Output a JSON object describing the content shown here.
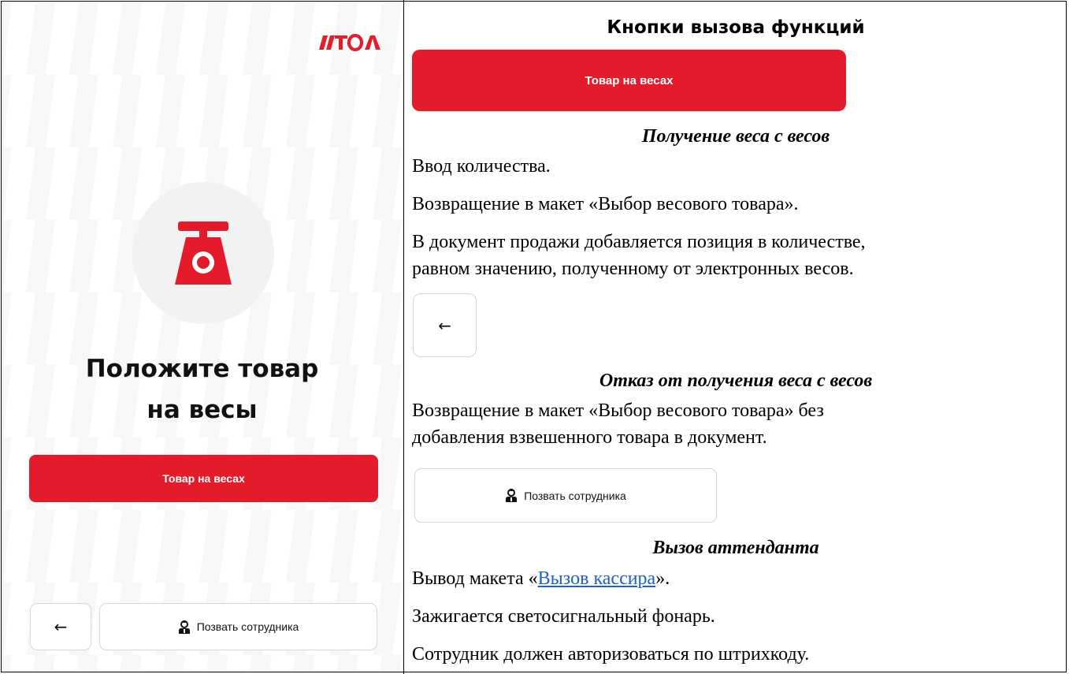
{
  "phone": {
    "logo": "ATOL",
    "title_line1": "Положите товар",
    "title_line2": "на весы",
    "weigh_button": "Товар на весах",
    "back_arrow": "←",
    "call_button": "Позвать сотрудника",
    "accent_color": "#e31b2b",
    "icons": [
      "scale-icon",
      "back-arrow-icon",
      "person-icon"
    ]
  },
  "doc": {
    "heading": "Кнопки вызова функций",
    "weigh_button": "Товар на весах",
    "weigh_caption": "Получение веса с весов",
    "weigh_lines": [
      "Ввод количества.",
      "Возвращение в макет «Выбор весового товара».",
      "В документ продажи добавляется позиция в количестве,",
      "равном значению, полученному от электронных весов."
    ],
    "back_arrow": "←",
    "back_caption": "Отказ от получения веса с весов",
    "back_lines": [
      "Возвращение в макет «Выбор весового товара» без",
      "добавления взвешенного товара в документ."
    ],
    "call_button": "Позвать сотрудника",
    "call_caption": "Вызов аттенданта",
    "call_line1_prefix": "Вывод макета «",
    "call_line1_link": "Вызов кассира",
    "call_line1_suffix": "».",
    "call_lines": [
      "Зажигается светосигнальный фонарь.",
      "Сотрудник должен авторизоваться по штрихкоду."
    ],
    "link_color": "#1f5fc8"
  }
}
